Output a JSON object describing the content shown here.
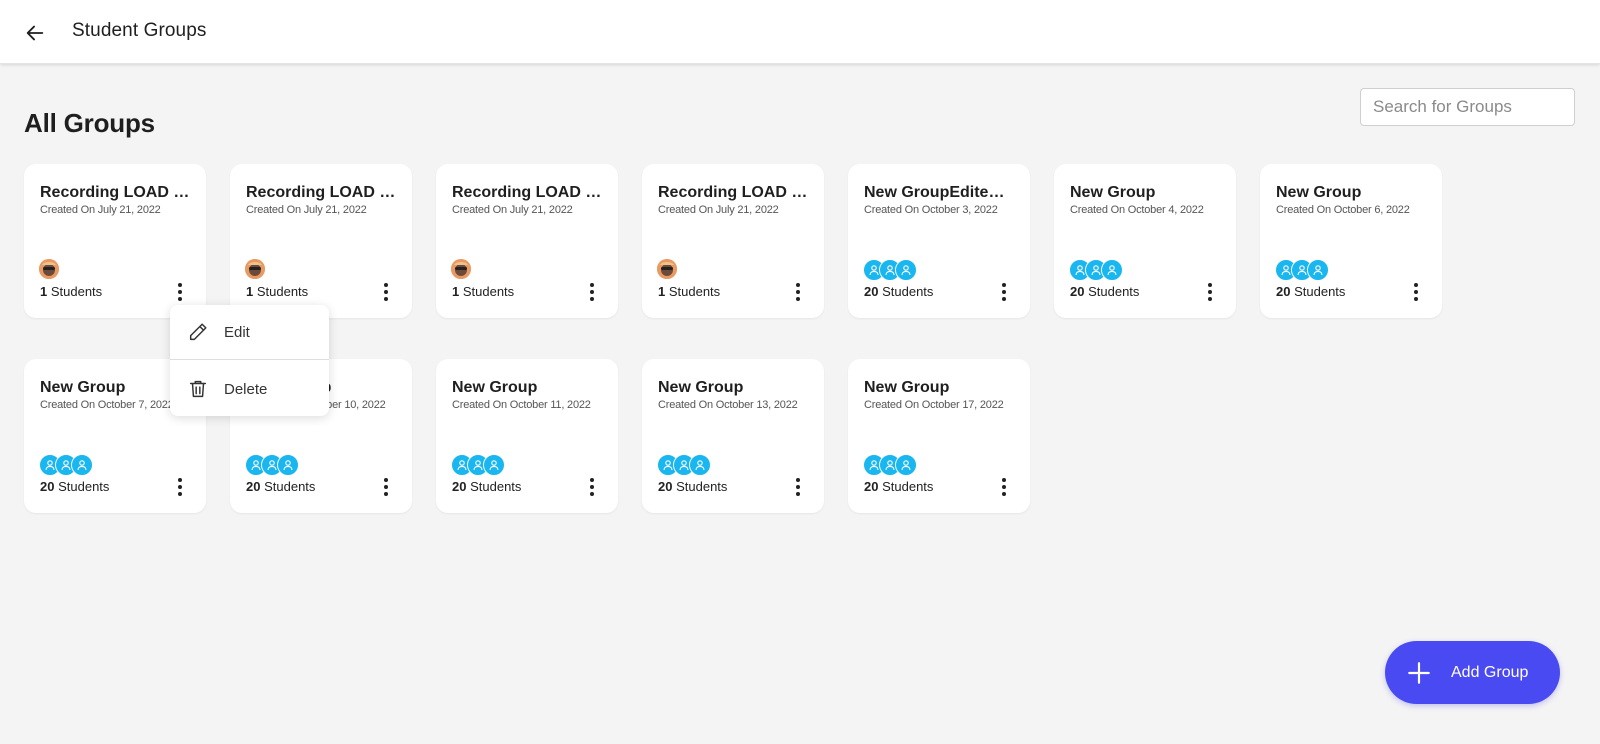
{
  "header": {
    "title": "Student Groups",
    "back_icon": "arrow-left-icon"
  },
  "section": {
    "title": "All Groups"
  },
  "search": {
    "placeholder": "Search for Groups",
    "value": ""
  },
  "created_prefix": "Created On",
  "students_label": "Students",
  "groups": [
    {
      "name": "Recording LOAD T...",
      "date": "July 21, 2022",
      "count": "1",
      "avatar": "photo"
    },
    {
      "name": "Recording LOAD T...",
      "date": "July 21, 2022",
      "count": "1",
      "avatar": "photo"
    },
    {
      "name": "Recording LOAD T...",
      "date": "July 21, 2022",
      "count": "1",
      "avatar": "photo"
    },
    {
      "name": "Recording LOAD T...",
      "date": "July 21, 2022",
      "count": "1",
      "avatar": "photo"
    },
    {
      "name": "New GroupEdited ...",
      "date": "October 3, 2022",
      "count": "20",
      "avatar": "group"
    },
    {
      "name": "New Group",
      "date": "October 4, 2022",
      "count": "20",
      "avatar": "group"
    },
    {
      "name": "New Group",
      "date": "October 6, 2022",
      "count": "20",
      "avatar": "group"
    },
    {
      "name": "New Group",
      "date": "October 7, 2022",
      "count": "20",
      "avatar": "group"
    },
    {
      "name": "New Group",
      "date": "October 10, 2022",
      "count": "20",
      "avatar": "group"
    },
    {
      "name": "New Group",
      "date": "October 11, 2022",
      "count": "20",
      "avatar": "group"
    },
    {
      "name": "New Group",
      "date": "October 13, 2022",
      "count": "20",
      "avatar": "group"
    },
    {
      "name": "New Group",
      "date": "October 17, 2022",
      "count": "20",
      "avatar": "group"
    }
  ],
  "context_menu": {
    "open_for_card": 0,
    "items": [
      {
        "label": "Edit",
        "icon": "pencil-icon"
      },
      {
        "label": "Delete",
        "icon": "trash-icon"
      }
    ]
  },
  "fab": {
    "label": "Add Group",
    "icon": "plus-icon"
  },
  "colors": {
    "accent": "#4a4af2",
    "avatar_blue": "#19b6f0",
    "avatar_photo": "#e8a06a"
  }
}
